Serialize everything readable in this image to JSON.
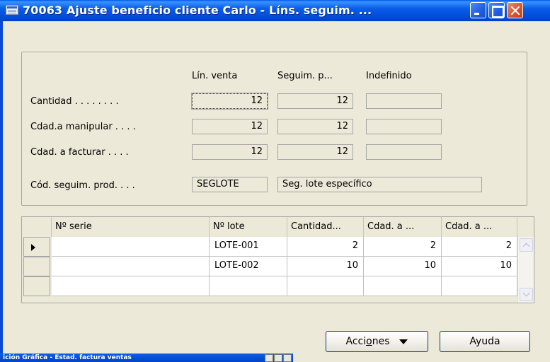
{
  "window": {
    "title": "70063 Ajuste beneficio cliente Carlo - Líns. seguim. ..."
  },
  "summary": {
    "columns": [
      "Lín. venta",
      "Seguim. p...",
      "Indefinido"
    ],
    "rows": [
      {
        "label": "Cantidad . . . . . . . .",
        "values": [
          "12",
          "12",
          ""
        ]
      },
      {
        "label": "Cdad.a manipular . . . .",
        "values": [
          "12",
          "12",
          ""
        ]
      },
      {
        "label": "Cdad. a facturar . . . .",
        "values": [
          "12",
          "12",
          ""
        ]
      }
    ],
    "tracking_code": {
      "label": "Cód. seguim. prod. . . .",
      "code": "SEGLOTE",
      "description": "Seg. lote específico"
    }
  },
  "grid": {
    "headers": [
      "Nº serie",
      "Nº lote",
      "Cantidad...",
      "Cdad. a ...",
      "Cdad. a ..."
    ],
    "rows": [
      {
        "serie": "",
        "lote": "LOTE-001",
        "cantidad": "2",
        "cdad_manip": "2",
        "cdad_fact": "2"
      },
      {
        "serie": "",
        "lote": "LOTE-002",
        "cantidad": "10",
        "cdad_manip": "10",
        "cdad_fact": "10"
      },
      {
        "serie": "",
        "lote": "",
        "cantidad": "",
        "cdad_manip": "",
        "cdad_fact": ""
      }
    ]
  },
  "buttons": {
    "actions": {
      "pre": "Acci",
      "u": "o",
      "post": "nes"
    },
    "help": "Ayuda"
  },
  "background_window": {
    "title": "ición Gráfica - Estad. factura ventas"
  }
}
